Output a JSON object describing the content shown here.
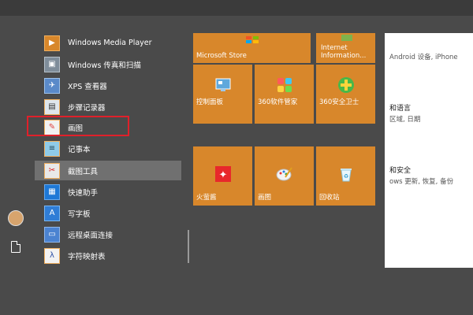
{
  "app_list": {
    "items": [
      {
        "label": "Windows Media Player",
        "icon": "media-player-icon"
      },
      {
        "label": "Windows 传真和扫描",
        "icon": "fax-scan-icon"
      },
      {
        "label": "XPS 查看器",
        "icon": "xps-viewer-icon"
      },
      {
        "label": "步骤记录器",
        "icon": "steps-recorder-icon"
      },
      {
        "label": "画图",
        "icon": "paint-icon"
      },
      {
        "label": "记事本",
        "icon": "notepad-icon"
      },
      {
        "label": "截图工具",
        "icon": "snipping-tool-icon"
      },
      {
        "label": "快速助手",
        "icon": "quick-assist-icon"
      },
      {
        "label": "写字板",
        "icon": "wordpad-icon"
      },
      {
        "label": "远程桌面连接",
        "icon": "remote-desktop-icon"
      },
      {
        "label": "字符映射表",
        "icon": "character-map-icon"
      }
    ]
  },
  "tiles": {
    "microsoft_store": "Microsoft Store",
    "internet_information": "Internet Information...",
    "control_panel": "控制面板",
    "software_manager_360": "360软件管家",
    "security_guard_360": "360安全卫士",
    "tinder": "火萤酱",
    "paint": "画图",
    "recycle_bin": "回收站"
  },
  "settings": {
    "line1": "Android 设备, iPhone",
    "heading2": "和语言",
    "line2": "区域, 日期",
    "heading3": "和安全",
    "line3": "ows 更新, 恢复, 备份"
  },
  "colors": {
    "tile": "#d8872b",
    "highlight": "#e0202a",
    "background": "#4a4a4a"
  }
}
